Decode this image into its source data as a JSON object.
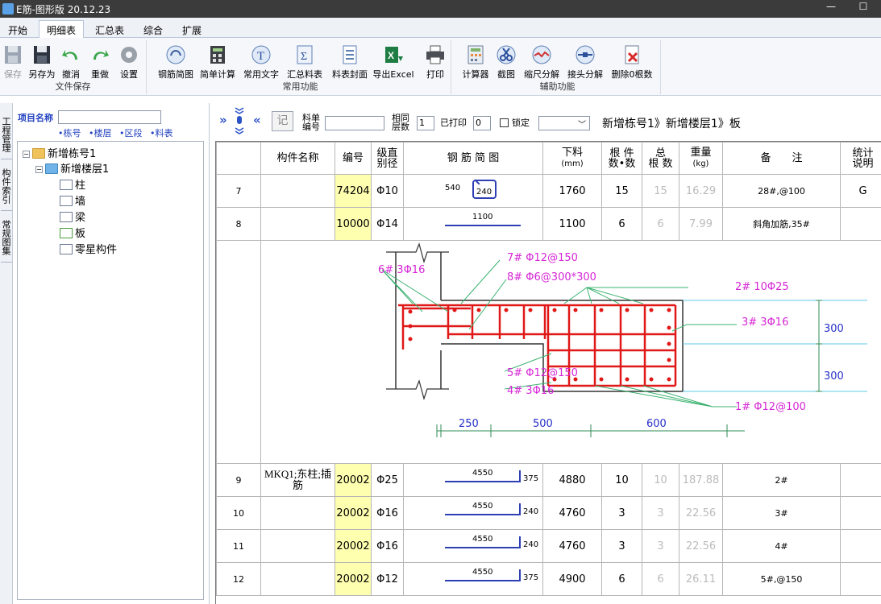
{
  "window": {
    "title": "E筋-图形版 20.12.23",
    "min_glyph": "—",
    "max_glyph": "☐"
  },
  "menu": {
    "tabs": [
      "开始",
      "明细表",
      "汇总表",
      "综合",
      "扩展"
    ],
    "active": "明细表"
  },
  "ribbon": {
    "groups": [
      {
        "name": "文件保存",
        "buttons": [
          "保存",
          "另存为",
          "撤消",
          "重做",
          "设置"
        ]
      },
      {
        "name": "常用功能",
        "buttons": [
          "钢筋简图",
          "简单计算",
          "常用文字",
          "汇总料表",
          "料表封面",
          "导出Excel",
          "打印"
        ]
      },
      {
        "name": "辅助功能",
        "buttons": [
          "计算器",
          "截图",
          "缩尺分解",
          "接头分解",
          "删除0根数"
        ]
      }
    ],
    "icons": [
      "save-icon",
      "save-as-icon",
      "undo-icon",
      "redo-icon",
      "settings-gear-icon",
      "rebar-sketch-icon",
      "calculator-icon",
      "text-icon",
      "sum-icon",
      "cover-icon",
      "excel-icon",
      "printer-icon",
      "calc-icon",
      "scissors-icon",
      "scale-icon",
      "splice-icon",
      "delete-icon"
    ]
  },
  "sidetabs": [
    "工程管理",
    "构件索引",
    "常规图集"
  ],
  "left": {
    "project_label": "项目名称",
    "project_value": "",
    "filters": [
      "•栋号",
      "•楼层",
      "•区段",
      "•料表"
    ],
    "tree": {
      "building": "新增栋号1",
      "floor": "新增楼层1",
      "items": [
        "柱",
        "墙",
        "梁",
        "板",
        "零星构件"
      ],
      "selected": "板"
    }
  },
  "toolbar": {
    "nav_prev": "»",
    "nav_next": "«",
    "ji_label": "记",
    "material_label_1": "料单",
    "material_label_2": "编号",
    "material_value": "",
    "same_label_1": "相同",
    "same_label_2": "层数",
    "same_value": "1",
    "printed_label": "已打印",
    "printed_value": "0",
    "lock_label": "锁定",
    "dropdown_value": "",
    "breadcrumb": "新增栋号1》新增楼层1》板"
  },
  "table": {
    "headers": [
      "",
      "构件名称",
      "编号",
      "级直别径",
      "钢 筋 简 图",
      "下料(mm)",
      "根 件数•数",
      "总根 数",
      "重量(kg)",
      "备　　注",
      "统计说明"
    ],
    "header_lines": {
      "grade": [
        "级直",
        "别径"
      ],
      "cut": [
        "下料",
        "(mm)"
      ],
      "count": [
        "根 件",
        "数•数"
      ],
      "total": [
        "总",
        "根 数"
      ],
      "weight": [
        "重量",
        "(kg)"
      ],
      "stat": [
        "统计",
        "说明"
      ]
    },
    "rows": [
      {
        "idx": "7",
        "name": "",
        "code": "74204",
        "grade": "Φ10",
        "sketch": {
          "left": "540",
          "right": "240",
          "kind": "stirrup"
        },
        "cut": "1760",
        "count": "15",
        "total": "15",
        "weight": "16.29",
        "note": "28#,@100",
        "stat": "G"
      },
      {
        "idx": "8",
        "name": "",
        "code": "10000",
        "grade": "Φ14",
        "sketch": {
          "top": "1100",
          "kind": "straight"
        },
        "cut": "1100",
        "count": "6",
        "total": "6",
        "weight": "7.99",
        "note": "斜角加筋,35#",
        "stat": ""
      },
      {
        "idx": "9",
        "name": "MKQ1;东柱;插筋",
        "code": "20002",
        "grade": "Φ25",
        "sketch": {
          "top": "4550",
          "right": "375",
          "kind": "hook"
        },
        "cut": "4880",
        "count": "10",
        "total": "10",
        "weight": "187.88",
        "note": "2#",
        "stat": ""
      },
      {
        "idx": "10",
        "name": "",
        "code": "20002",
        "grade": "Φ16",
        "sketch": {
          "top": "4550",
          "right": "240",
          "kind": "hook"
        },
        "cut": "4760",
        "count": "3",
        "total": "3",
        "weight": "22.56",
        "note": "3#",
        "stat": ""
      },
      {
        "idx": "11",
        "name": "",
        "code": "20002",
        "grade": "Φ16",
        "sketch": {
          "top": "4550",
          "right": "240",
          "kind": "hook"
        },
        "cut": "4760",
        "count": "3",
        "total": "3",
        "weight": "22.56",
        "note": "4#",
        "stat": ""
      },
      {
        "idx": "12",
        "name": "",
        "code": "20002",
        "grade": "Φ12",
        "sketch": {
          "top": "4550",
          "right": "375",
          "kind": "hook"
        },
        "cut": "4900",
        "count": "6",
        "total": "6",
        "weight": "26.11",
        "note": "5#,@150",
        "stat": ""
      }
    ]
  },
  "diagram": {
    "labels": {
      "l7": "7# Φ12@150",
      "l6": "6# 3Φ16",
      "l8": "8# Φ6@300*300",
      "l2": "2# 10Φ25",
      "l3": "3# 3Φ16",
      "l5": "5# Φ12@150",
      "l4": "4# 3Φ16",
      "l1": "1# Φ12@100"
    },
    "dims": {
      "h1": "300",
      "h2": "300",
      "w1": "250",
      "w2": "500",
      "w3": "600"
    },
    "colors": {
      "rebar": "#e01818",
      "label_magenta": "#d626d6",
      "label_blue": "#2630c8",
      "leader": "#3cb371",
      "dim": "#2e8b57",
      "outline": "#333333",
      "extension": "#5ec8e8"
    }
  }
}
